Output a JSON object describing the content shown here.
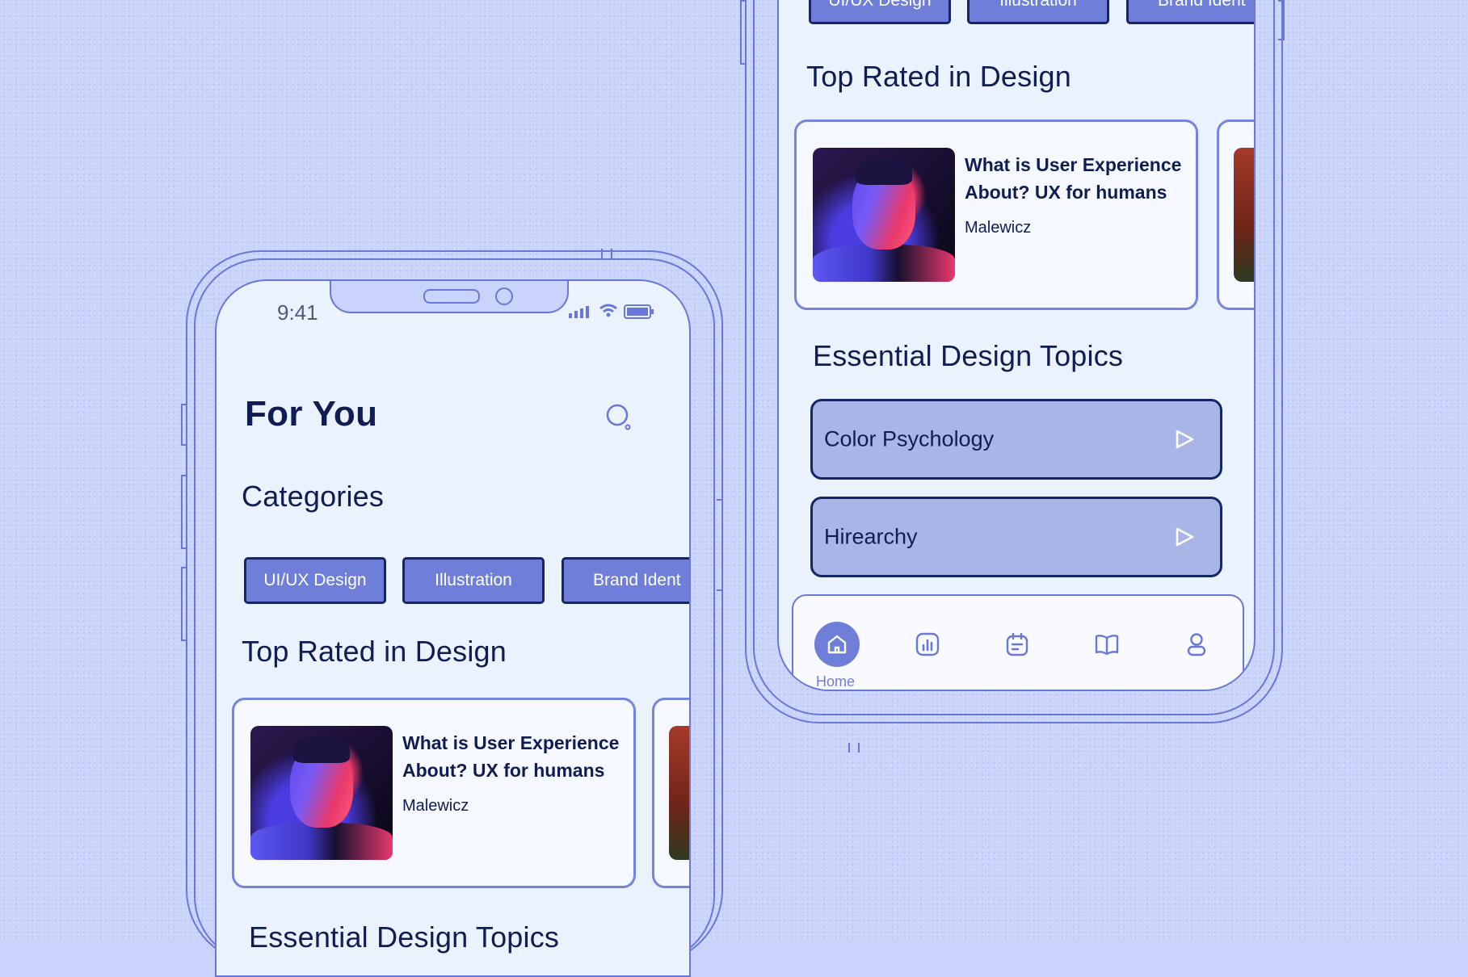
{
  "status_bar": {
    "time": "9:41"
  },
  "for_you": {
    "title": "For You",
    "categories_heading": "Categories",
    "categories": [
      "UI/UX Design",
      "Illustration",
      "Brand Ident"
    ],
    "top_rated_heading": "Top Rated in Design",
    "card": {
      "title_line1": "What is User Experience",
      "title_line2": "About? UX for humans",
      "author": "Malewicz"
    },
    "topics_heading": "Essential Design Topics"
  },
  "scrolled": {
    "categories": [
      "UI/UX Design",
      "Illustration",
      "Brand Ident"
    ],
    "top_rated_heading": "Top Rated in Design",
    "card": {
      "title_line1": "What is User Experience",
      "title_line2": "About? UX for humans",
      "author": "Malewicz"
    },
    "topics_heading": "Essential Design Topics",
    "topics": [
      {
        "label": "Color Psychology"
      },
      {
        "label": "Hirearchy"
      }
    ],
    "nav": {
      "home_label": "Home",
      "icons": [
        "home-icon",
        "stats-icon",
        "calendar-icon",
        "book-icon",
        "profile-icon"
      ]
    }
  },
  "colors": {
    "accent": "#6f7fd9",
    "dark": "#142568",
    "screen": "#eaf2fe",
    "background": "#c9d3fb"
  }
}
